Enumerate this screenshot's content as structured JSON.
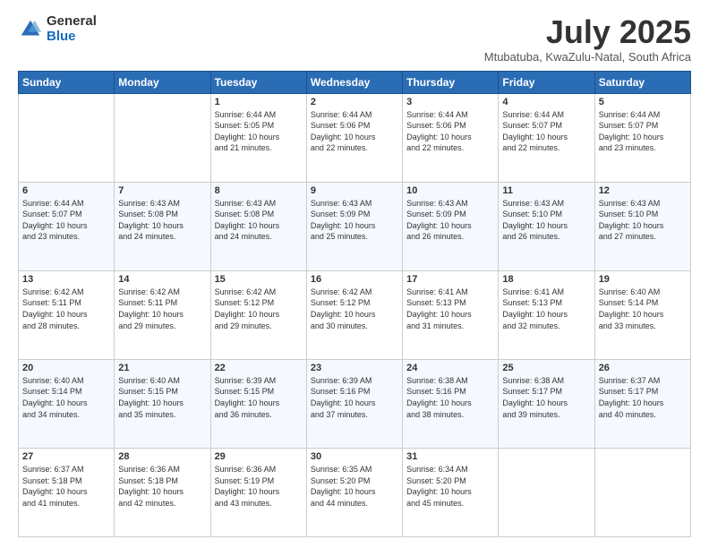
{
  "header": {
    "logo_general": "General",
    "logo_blue": "Blue",
    "month_title": "July 2025",
    "subtitle": "Mtubatuba, KwaZulu-Natal, South Africa"
  },
  "weekdays": [
    "Sunday",
    "Monday",
    "Tuesday",
    "Wednesday",
    "Thursday",
    "Friday",
    "Saturday"
  ],
  "weeks": [
    [
      {
        "day": "",
        "info": ""
      },
      {
        "day": "",
        "info": ""
      },
      {
        "day": "1",
        "info": "Sunrise: 6:44 AM\nSunset: 5:05 PM\nDaylight: 10 hours\nand 21 minutes."
      },
      {
        "day": "2",
        "info": "Sunrise: 6:44 AM\nSunset: 5:06 PM\nDaylight: 10 hours\nand 22 minutes."
      },
      {
        "day": "3",
        "info": "Sunrise: 6:44 AM\nSunset: 5:06 PM\nDaylight: 10 hours\nand 22 minutes."
      },
      {
        "day": "4",
        "info": "Sunrise: 6:44 AM\nSunset: 5:07 PM\nDaylight: 10 hours\nand 22 minutes."
      },
      {
        "day": "5",
        "info": "Sunrise: 6:44 AM\nSunset: 5:07 PM\nDaylight: 10 hours\nand 23 minutes."
      }
    ],
    [
      {
        "day": "6",
        "info": "Sunrise: 6:44 AM\nSunset: 5:07 PM\nDaylight: 10 hours\nand 23 minutes."
      },
      {
        "day": "7",
        "info": "Sunrise: 6:43 AM\nSunset: 5:08 PM\nDaylight: 10 hours\nand 24 minutes."
      },
      {
        "day": "8",
        "info": "Sunrise: 6:43 AM\nSunset: 5:08 PM\nDaylight: 10 hours\nand 24 minutes."
      },
      {
        "day": "9",
        "info": "Sunrise: 6:43 AM\nSunset: 5:09 PM\nDaylight: 10 hours\nand 25 minutes."
      },
      {
        "day": "10",
        "info": "Sunrise: 6:43 AM\nSunset: 5:09 PM\nDaylight: 10 hours\nand 26 minutes."
      },
      {
        "day": "11",
        "info": "Sunrise: 6:43 AM\nSunset: 5:10 PM\nDaylight: 10 hours\nand 26 minutes."
      },
      {
        "day": "12",
        "info": "Sunrise: 6:43 AM\nSunset: 5:10 PM\nDaylight: 10 hours\nand 27 minutes."
      }
    ],
    [
      {
        "day": "13",
        "info": "Sunrise: 6:42 AM\nSunset: 5:11 PM\nDaylight: 10 hours\nand 28 minutes."
      },
      {
        "day": "14",
        "info": "Sunrise: 6:42 AM\nSunset: 5:11 PM\nDaylight: 10 hours\nand 29 minutes."
      },
      {
        "day": "15",
        "info": "Sunrise: 6:42 AM\nSunset: 5:12 PM\nDaylight: 10 hours\nand 29 minutes."
      },
      {
        "day": "16",
        "info": "Sunrise: 6:42 AM\nSunset: 5:12 PM\nDaylight: 10 hours\nand 30 minutes."
      },
      {
        "day": "17",
        "info": "Sunrise: 6:41 AM\nSunset: 5:13 PM\nDaylight: 10 hours\nand 31 minutes."
      },
      {
        "day": "18",
        "info": "Sunrise: 6:41 AM\nSunset: 5:13 PM\nDaylight: 10 hours\nand 32 minutes."
      },
      {
        "day": "19",
        "info": "Sunrise: 6:40 AM\nSunset: 5:14 PM\nDaylight: 10 hours\nand 33 minutes."
      }
    ],
    [
      {
        "day": "20",
        "info": "Sunrise: 6:40 AM\nSunset: 5:14 PM\nDaylight: 10 hours\nand 34 minutes."
      },
      {
        "day": "21",
        "info": "Sunrise: 6:40 AM\nSunset: 5:15 PM\nDaylight: 10 hours\nand 35 minutes."
      },
      {
        "day": "22",
        "info": "Sunrise: 6:39 AM\nSunset: 5:15 PM\nDaylight: 10 hours\nand 36 minutes."
      },
      {
        "day": "23",
        "info": "Sunrise: 6:39 AM\nSunset: 5:16 PM\nDaylight: 10 hours\nand 37 minutes."
      },
      {
        "day": "24",
        "info": "Sunrise: 6:38 AM\nSunset: 5:16 PM\nDaylight: 10 hours\nand 38 minutes."
      },
      {
        "day": "25",
        "info": "Sunrise: 6:38 AM\nSunset: 5:17 PM\nDaylight: 10 hours\nand 39 minutes."
      },
      {
        "day": "26",
        "info": "Sunrise: 6:37 AM\nSunset: 5:17 PM\nDaylight: 10 hours\nand 40 minutes."
      }
    ],
    [
      {
        "day": "27",
        "info": "Sunrise: 6:37 AM\nSunset: 5:18 PM\nDaylight: 10 hours\nand 41 minutes."
      },
      {
        "day": "28",
        "info": "Sunrise: 6:36 AM\nSunset: 5:18 PM\nDaylight: 10 hours\nand 42 minutes."
      },
      {
        "day": "29",
        "info": "Sunrise: 6:36 AM\nSunset: 5:19 PM\nDaylight: 10 hours\nand 43 minutes."
      },
      {
        "day": "30",
        "info": "Sunrise: 6:35 AM\nSunset: 5:20 PM\nDaylight: 10 hours\nand 44 minutes."
      },
      {
        "day": "31",
        "info": "Sunrise: 6:34 AM\nSunset: 5:20 PM\nDaylight: 10 hours\nand 45 minutes."
      },
      {
        "day": "",
        "info": ""
      },
      {
        "day": "",
        "info": ""
      }
    ]
  ]
}
